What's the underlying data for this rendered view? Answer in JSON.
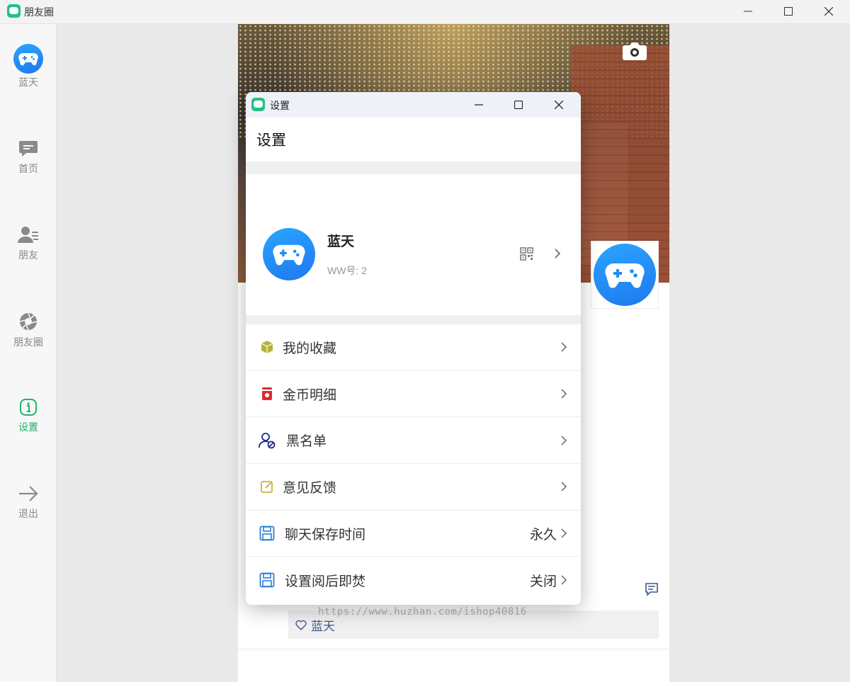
{
  "window": {
    "title": "朋友圈",
    "minimize": "minimize",
    "maximize": "maximize",
    "close": "close"
  },
  "sidebar": {
    "items": [
      {
        "label": "蓝天",
        "icon": "gamepad-avatar"
      },
      {
        "label": "首页",
        "icon": "chat-icon"
      },
      {
        "label": "朋友",
        "icon": "friends-icon"
      },
      {
        "label": "朋友圈",
        "icon": "aperture-icon"
      },
      {
        "label": "设置",
        "icon": "info-icon",
        "active": true
      },
      {
        "label": "退出",
        "icon": "arrow-right-icon"
      }
    ]
  },
  "moments": {
    "likes": "蓝天",
    "watermark": "https://www.huzhan.com/ishop40816"
  },
  "dialog": {
    "title": "设置",
    "header": "设置",
    "profile": {
      "name": "蓝天",
      "id_text": "WW号: 2"
    },
    "rows": [
      {
        "label": "我的收藏",
        "value": "",
        "icon": "cube-icon",
        "color": "#b5b43a"
      },
      {
        "label": "金币明细",
        "value": "",
        "icon": "coin-box-icon",
        "color": "#e02a2a"
      },
      {
        "label": "黑名单",
        "value": "",
        "icon": "blocked-user-icon",
        "color": "#1d2a8a"
      },
      {
        "label": "意见反馈",
        "value": "",
        "icon": "edit-icon",
        "color": "#c7b53a"
      },
      {
        "label": "聊天保存时间",
        "value": "永久",
        "icon": "save-icon",
        "color": "#2a7fd6"
      },
      {
        "label": "设置阅后即焚",
        "value": "关闭",
        "icon": "save-icon",
        "color": "#2a7fd6"
      }
    ]
  },
  "colors": {
    "accent": "#22b26d",
    "avatar_blue": "#1f8ff5"
  }
}
